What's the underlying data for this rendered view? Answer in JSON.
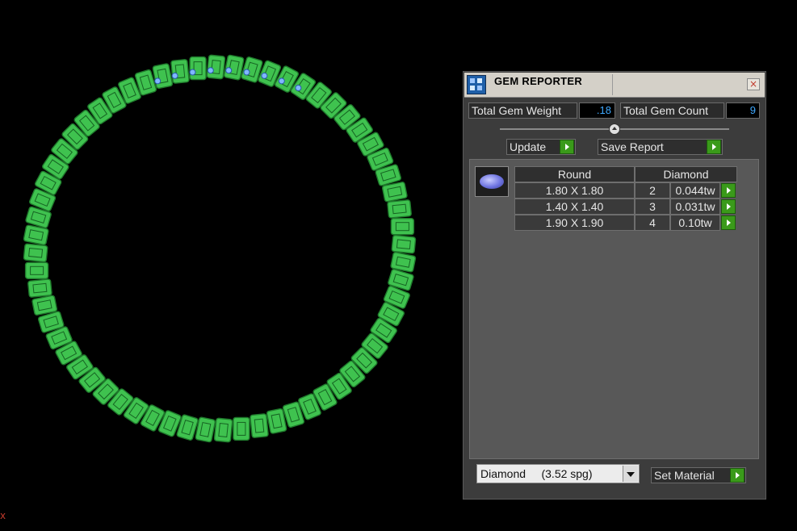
{
  "viewport": {
    "axis_label": "x"
  },
  "panel": {
    "title": "GEM REPORTER",
    "close_label": "×",
    "totals": {
      "weight_label": "Total Gem Weight",
      "weight_value": ".18",
      "count_label": "Total Gem Count",
      "count_value": "9"
    },
    "actions": {
      "update_label": "Update",
      "save_report_label": "Save Report"
    },
    "table": {
      "headers": [
        "Round",
        "Diamond"
      ],
      "rows": [
        {
          "size": "1.80 X 1.80",
          "count": "2",
          "weight": "0.044tw"
        },
        {
          "size": "1.40 X 1.40",
          "count": "3",
          "weight": "0.031tw"
        },
        {
          "size": "1.90 X 1.90",
          "count": "4",
          "weight": "0.10tw"
        }
      ]
    },
    "material": {
      "selected": "Diamond     (3.52 spg)",
      "set_label": "Set Material"
    }
  },
  "colors": {
    "ring_green": "#3fc24f",
    "accent_blue": "#3fa9ff",
    "go_green": "#3a9a1a",
    "gem_blue": "#6e74e0"
  },
  "icons": [
    "gem-reporter-app-icon",
    "close-icon",
    "play-arrow-icon",
    "gem-thumbnail-icon",
    "dropdown-arrow-icon"
  ]
}
